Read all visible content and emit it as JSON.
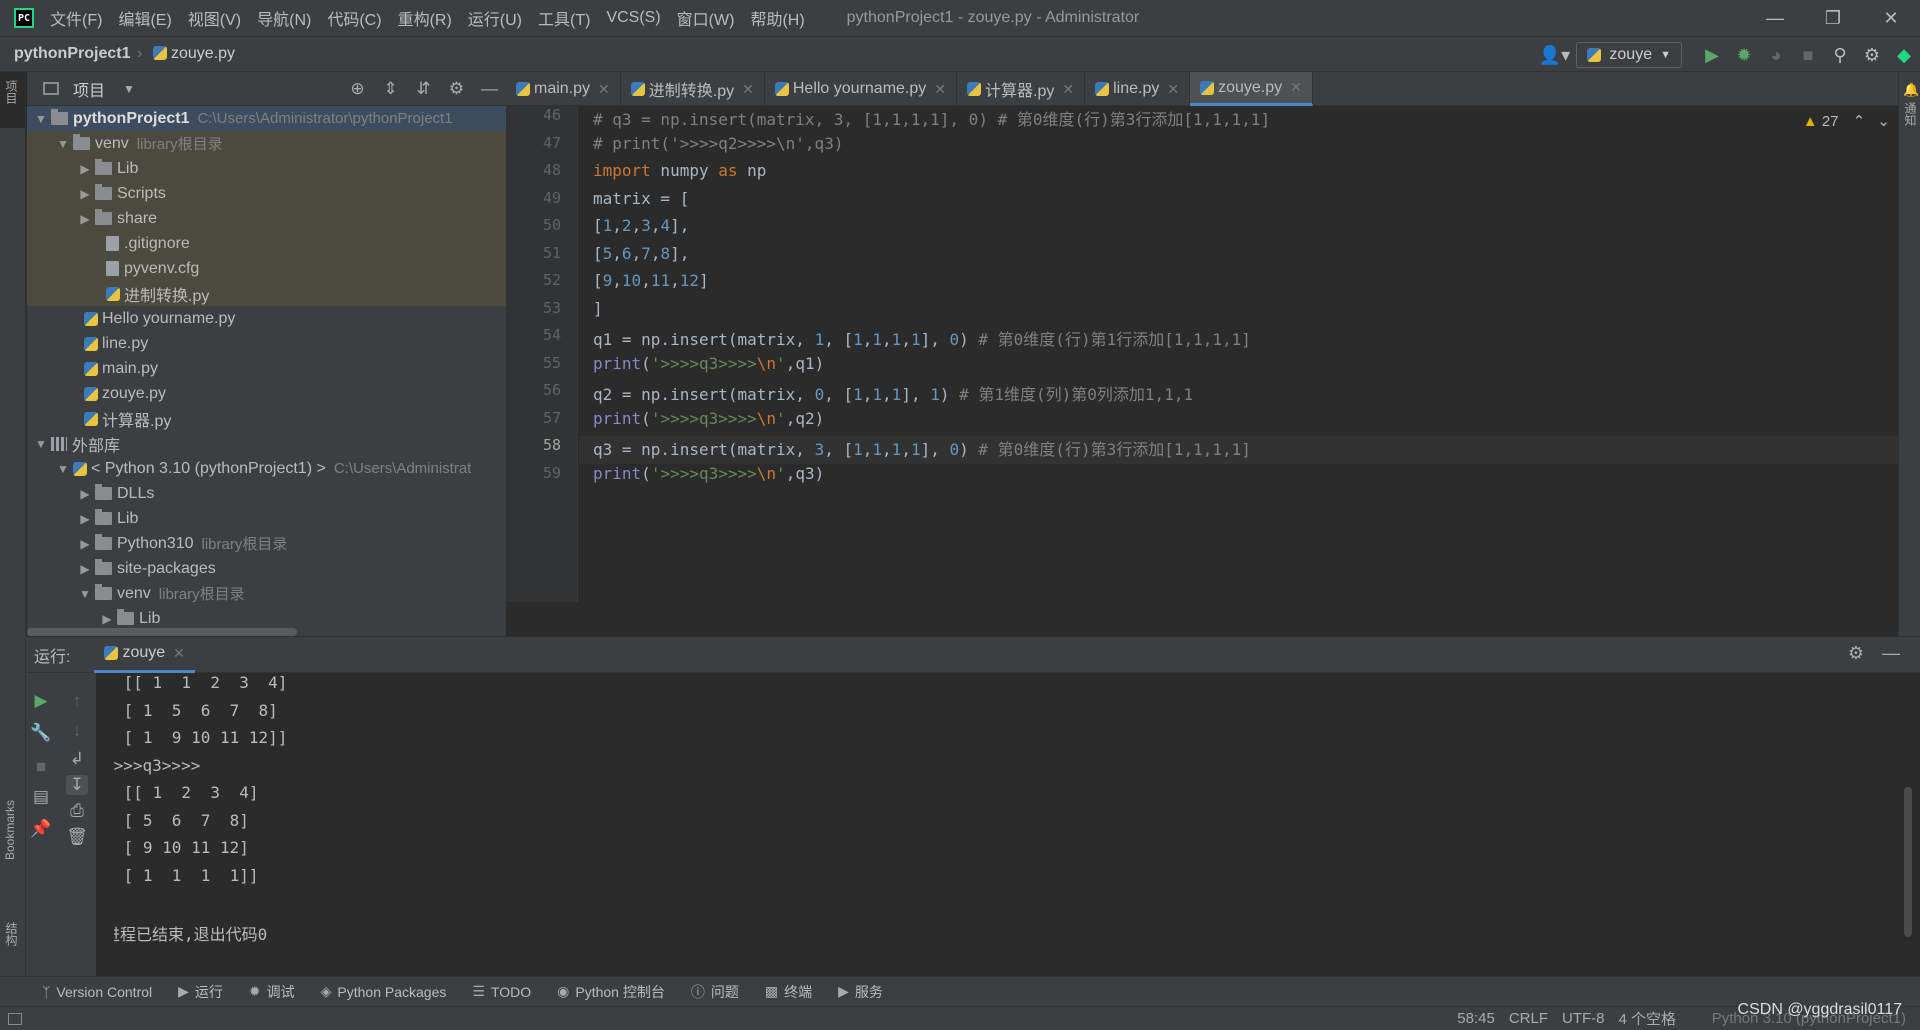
{
  "window": {
    "menus": [
      "文件(F)",
      "编辑(E)",
      "视图(V)",
      "导航(N)",
      "代码(C)",
      "重构(R)",
      "运行(U)",
      "工具(T)",
      "VCS(S)",
      "窗口(W)",
      "帮助(H)"
    ],
    "title": "pythonProject1 - zouye.py - Administrator"
  },
  "navbar": {
    "project": "pythonProject1",
    "file": "zouye.py",
    "run_config": "zouye"
  },
  "left_strip": {
    "project_label": "项目",
    "bookmarks_label": "Bookmarks",
    "structure_label": "结构"
  },
  "right_strip": {
    "notifications_label": "通知"
  },
  "project_panel": {
    "title": "项目",
    "tree": [
      {
        "label": "pythonProject1",
        "hint": "C:\\Users\\Administrator\\pythonProject1"
      },
      {
        "label": "venv",
        "hint": "library根目录"
      },
      {
        "label": "Lib"
      },
      {
        "label": "Scripts"
      },
      {
        "label": "share"
      },
      {
        "label": ".gitignore"
      },
      {
        "label": "pyvenv.cfg"
      },
      {
        "label": "进制转换.py"
      },
      {
        "label": "Hello yourname.py"
      },
      {
        "label": "line.py"
      },
      {
        "label": "main.py"
      },
      {
        "label": "zouye.py"
      },
      {
        "label": "计算器.py"
      },
      {
        "label": "外部库"
      },
      {
        "label": "< Python 3.10 (pythonProject1) >",
        "hint": "C:\\Users\\Administrat"
      },
      {
        "label": "DLLs"
      },
      {
        "label": "Lib"
      },
      {
        "label": "Python310",
        "hint": "library根目录"
      },
      {
        "label": "site-packages"
      },
      {
        "label": "venv",
        "hint": "library根目录"
      },
      {
        "label": "Lib"
      }
    ]
  },
  "editor": {
    "tabs": [
      "main.py",
      "进制转换.py",
      "Hello yourname.py",
      "计算器.py",
      "line.py",
      "zouye.py"
    ],
    "active_tab": "zouye.py",
    "warnings": "27",
    "line_numbers": [
      "46",
      "47",
      "48",
      "49",
      "50",
      "51",
      "52",
      "53",
      "54",
      "55",
      "56",
      "57",
      "58",
      "59"
    ],
    "current_line": "58"
  },
  "run_panel": {
    "label": "运行:",
    "tab": "zouye",
    "output": [
      " [[ 1  1  2  3  4]",
      " [ 1  5  6  7  8]",
      " [ 1  9 10 11 12]]",
      ">>>>q3>>>>",
      " [[ 1  2  3  4]",
      " [ 5  6  7  8]",
      " [ 9 10 11 12]",
      " [ 1  1  1  1]]",
      "",
      "进程已结束,退出代码0"
    ]
  },
  "bottom_tools": [
    "Version Control",
    "运行",
    "调试",
    "Python Packages",
    "TODO",
    "Python 控制台",
    "问题",
    "终端",
    "服务"
  ],
  "statusbar": {
    "position": "58:45",
    "line_sep": "CRLF",
    "encoding": "UTF-8",
    "indent": "4 个空格",
    "interpreter": "Python 3.10 (pythonProject1)"
  },
  "watermark": "CSDN @yggdrasil0117"
}
